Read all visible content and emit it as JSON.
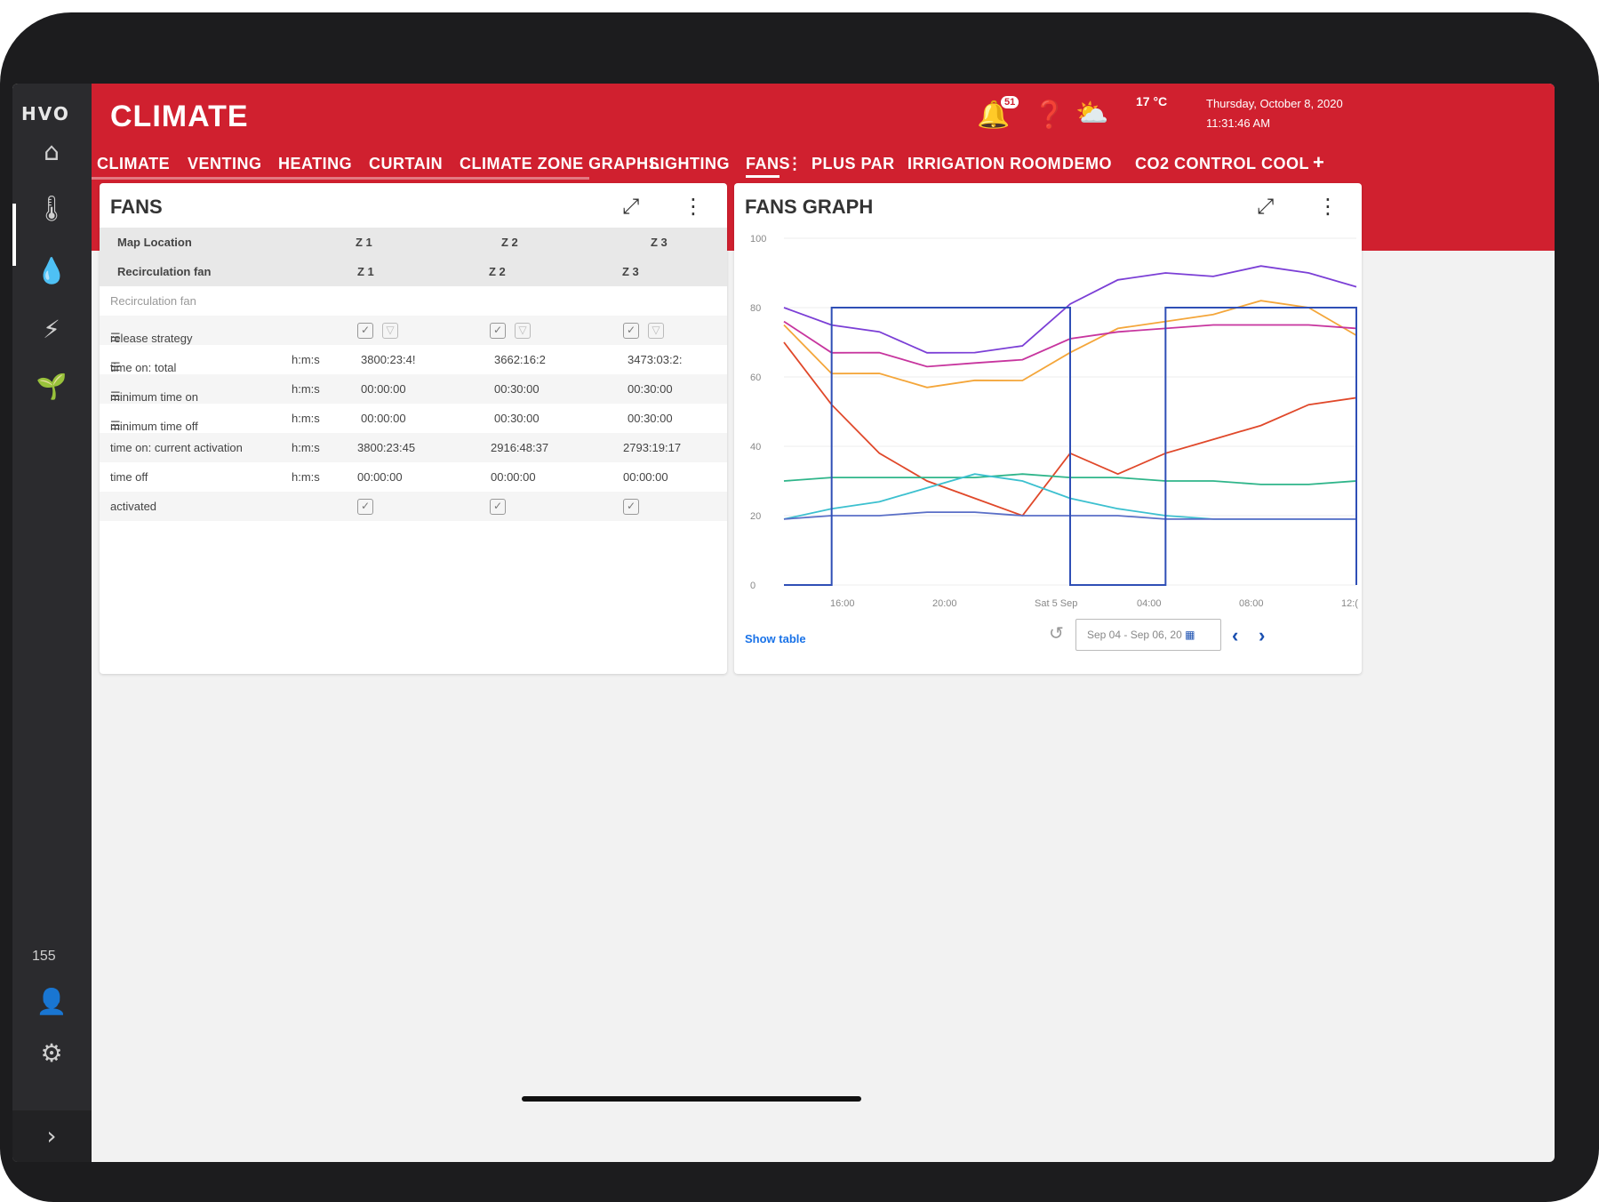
{
  "app": {
    "logo": "HVO",
    "title": "CLIMATE"
  },
  "header": {
    "notification_count": "51",
    "temperature": "17 °C",
    "date_line1": "Thursday, October 8, 2020",
    "date_line2": "11:31:46 AM"
  },
  "sidebar": {
    "count_label": "155"
  },
  "tabs": [
    "CLIMATE",
    "VENTING",
    "HEATING",
    "CURTAIN",
    "CLIMATE ZONE GRAPHS",
    "LIGHTING",
    "FANS",
    "PLUS PAR",
    "IRRIGATION ROOM",
    "DEMO",
    "CO2 CONTROL",
    "COOL"
  ],
  "active_tab": "FANS",
  "fans_card": {
    "title": "FANS",
    "map_location": {
      "label": "Map Location",
      "values": [
        "Z 1",
        "Z 2",
        "Z 3"
      ]
    },
    "recirculation_fan": {
      "label": "Recirculation fan",
      "values": [
        "Z 1",
        "Z 2",
        "Z 3"
      ]
    },
    "section_label": "Recirculation fan",
    "rows": [
      {
        "label": "release strategy",
        "unit": "",
        "values": [
          "",
          "",
          ""
        ],
        "type": "strategy"
      },
      {
        "label": "time on: total",
        "unit": "h:m:s",
        "values": [
          "3800:23:4!",
          "3662:16:2",
          "3473:03:2:"
        ],
        "type": "value"
      },
      {
        "label": "minimum time on",
        "unit": "h:m:s",
        "values": [
          "00:00:00",
          "00:30:00",
          "00:30:00"
        ],
        "type": "value"
      },
      {
        "label": "minimum time off",
        "unit": "h:m:s",
        "values": [
          "00:00:00",
          "00:30:00",
          "00:30:00"
        ],
        "type": "value"
      },
      {
        "label": "time on: current activation",
        "unit": "h:m:s",
        "values": [
          "3800:23:45",
          "2916:48:37",
          "2793:19:17"
        ],
        "type": "value"
      },
      {
        "label": "time off",
        "unit": "h:m:s",
        "values": [
          "00:00:00",
          "00:00:00",
          "00:00:00"
        ],
        "type": "value"
      },
      {
        "label": "activated",
        "unit": "",
        "values": [
          "",
          "",
          ""
        ],
        "type": "check"
      }
    ]
  },
  "graph_card": {
    "title": "FANS GRAPH",
    "show_table_label": "Show table",
    "date_range": "Sep 04 - Sep 06, 20",
    "y_ticks": [
      "100",
      "80",
      "60",
      "40",
      "20",
      "0"
    ],
    "x_ticks": [
      "16:00",
      "20:00",
      "Sat 5 Sep",
      "04:00",
      "08:00",
      "12:("
    ]
  },
  "chart_data": {
    "type": "line",
    "ylim": [
      0,
      100
    ],
    "grid": true,
    "legend": "none",
    "x": [
      "12:00",
      "14:00",
      "16:00",
      "18:00",
      "20:00",
      "22:00",
      "Sat 5 Sep",
      "02:00",
      "04:00",
      "06:00",
      "08:00",
      "10:00",
      "12:00"
    ],
    "series": [
      {
        "color": "#7b3fd6",
        "values": [
          80,
          76,
          72,
          68,
          66,
          70,
          80,
          88,
          90,
          89,
          92,
          90,
          86
        ]
      },
      {
        "color": "#f4a63a",
        "values": [
          75,
          62,
          60,
          58,
          58,
          60,
          66,
          74,
          76,
          78,
          82,
          80,
          72
        ]
      },
      {
        "color": "#c7359e",
        "values": [
          76,
          68,
          66,
          64,
          63,
          66,
          70,
          73,
          74,
          75,
          75,
          75,
          74
        ]
      },
      {
        "color": "#e0482a",
        "values": [
          70,
          52,
          38,
          30,
          25,
          20,
          38,
          32,
          38,
          42,
          46,
          52,
          54
        ]
      },
      {
        "color": "#2fb58a",
        "values": [
          30,
          31,
          31,
          31,
          31,
          32,
          31,
          31,
          30,
          30,
          29,
          29,
          30
        ]
      },
      {
        "color": "#3cc0cf",
        "values": [
          19,
          22,
          24,
          28,
          32,
          30,
          25,
          22,
          20,
          19,
          19,
          19,
          19
        ]
      },
      {
        "color": "#5a6fc7",
        "values": [
          19,
          20,
          20,
          21,
          21,
          20,
          20,
          20,
          19,
          19,
          19,
          19,
          19
        ]
      },
      {
        "color": "#2f4fb6",
        "values": [
          0,
          80,
          80,
          80,
          80,
          80,
          0,
          0,
          80,
          80,
          80,
          80,
          0
        ]
      }
    ]
  }
}
